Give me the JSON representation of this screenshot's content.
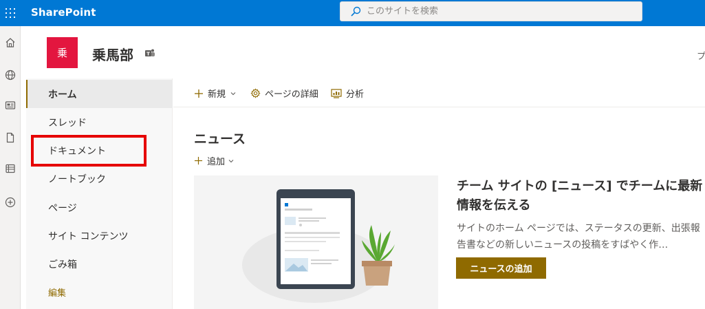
{
  "topbar": {
    "brand": "SharePoint",
    "search_placeholder": "このサイトを検索"
  },
  "app_rail": {
    "icons": [
      "home-icon",
      "globe-icon",
      "news-icon",
      "document-icon",
      "list-icon",
      "add-icon"
    ]
  },
  "site": {
    "logo_text": "乗",
    "title": "乗馬部",
    "privacy": "プライベ",
    "accent_color": "#8f6a00",
    "logo_color": "#e3163f"
  },
  "nav": {
    "items": [
      {
        "label": "ホーム"
      },
      {
        "label": "スレッド"
      },
      {
        "label": "ドキュメント"
      },
      {
        "label": "ノートブック"
      },
      {
        "label": "ページ"
      },
      {
        "label": "サイト コンテンツ"
      },
      {
        "label": "ごみ箱"
      }
    ],
    "edit_label": "編集"
  },
  "commandbar": {
    "new_label": "新規",
    "page_details_label": "ページの詳細",
    "analytics_label": "分析"
  },
  "news": {
    "section_title": "ニュース",
    "add_label": "追加",
    "heading": "チーム サイトの [ニュース] でチームに最新情報を伝える",
    "description": "サイトのホーム ページでは、ステータスの更新、出張報告書などの新しいニュースの投稿をすばやく作…",
    "add_button": "ニュースの追加"
  }
}
